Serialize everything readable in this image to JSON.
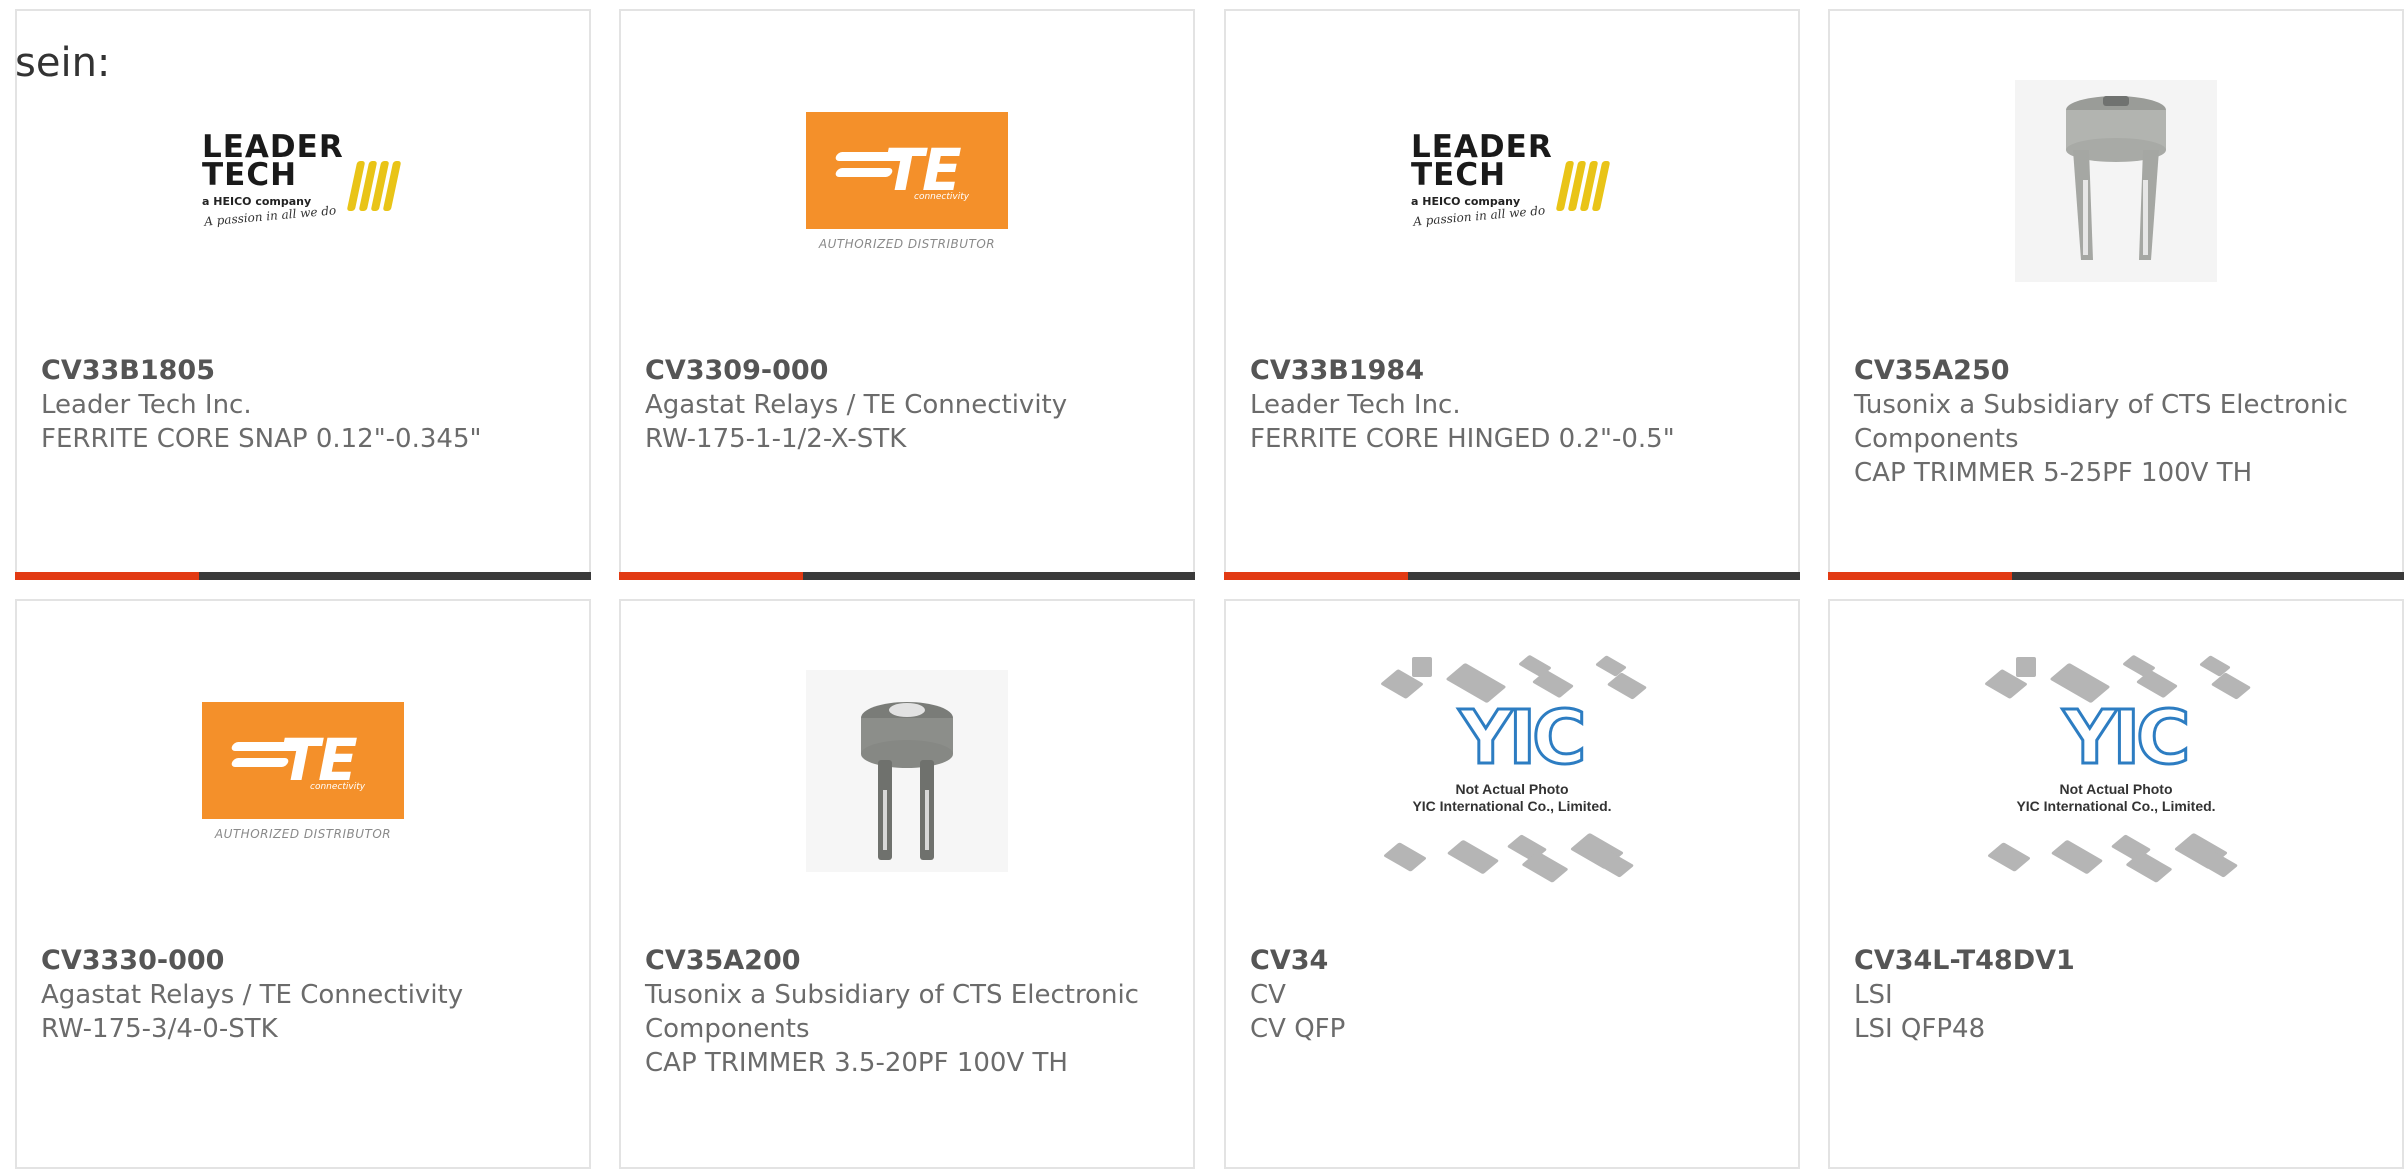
{
  "page": {
    "heading": "sein:"
  },
  "products": [
    {
      "part": "CV33B1805",
      "maker": "Leader Tech Inc.",
      "desc": "FERRITE CORE SNAP 0.12\"-0.345\"",
      "image": "leader-tech-logo"
    },
    {
      "part": "CV3309-000",
      "maker": "Agastat Relays / TE Connectivity",
      "desc": "RW-175-1-1/2-X-STK",
      "image": "te-connectivity-logo"
    },
    {
      "part": "CV33B1984",
      "maker": "Leader Tech Inc.",
      "desc": "FERRITE CORE HINGED 0.2\"-0.5\"",
      "image": "leader-tech-logo"
    },
    {
      "part": "CV35A250",
      "maker": "Tusonix a Subsidiary of CTS Electronic Components",
      "desc": "CAP TRIMMER 5-25PF 100V TH",
      "image": "trimmer-capacitor-photo"
    },
    {
      "part": "CV3330-000",
      "maker": "Agastat Relays / TE Connectivity",
      "desc": "RW-175-3/4-0-STK",
      "image": "te-connectivity-logo"
    },
    {
      "part": "CV35A200",
      "maker": "Tusonix a Subsidiary of CTS Electronic Components",
      "desc": "CAP TRIMMER 3.5-20PF 100V TH",
      "image": "trimmer-capacitor-photo"
    },
    {
      "part": "CV34",
      "maker": "CV",
      "desc": "CV QFP",
      "image": "yic-placeholder"
    },
    {
      "part": "CV34L-T48DV1",
      "maker": "LSI",
      "desc": "LSI QFP48",
      "image": "yic-placeholder"
    }
  ],
  "logos": {
    "leader_tech_line1": "LEADER",
    "leader_tech_line2": "TECH",
    "leader_tech_sub": "a HEICO company",
    "leader_tech_tagline": "A passion in all we do",
    "te_text": "TE",
    "te_connectivity": "connectivity",
    "te_authorized": "AUTHORIZED DISTRIBUTOR",
    "yic_text": "YIC",
    "yic_note_line1": "Not Actual Photo",
    "yic_note_line2": "YIC International Co., Limited."
  },
  "colors": {
    "accent": "#e23a13",
    "accent_track": "#3a3a3a",
    "te_orange": "#f4902a",
    "yic_blue": "#2d7dc2",
    "leader_yellow": "#e9c417"
  }
}
